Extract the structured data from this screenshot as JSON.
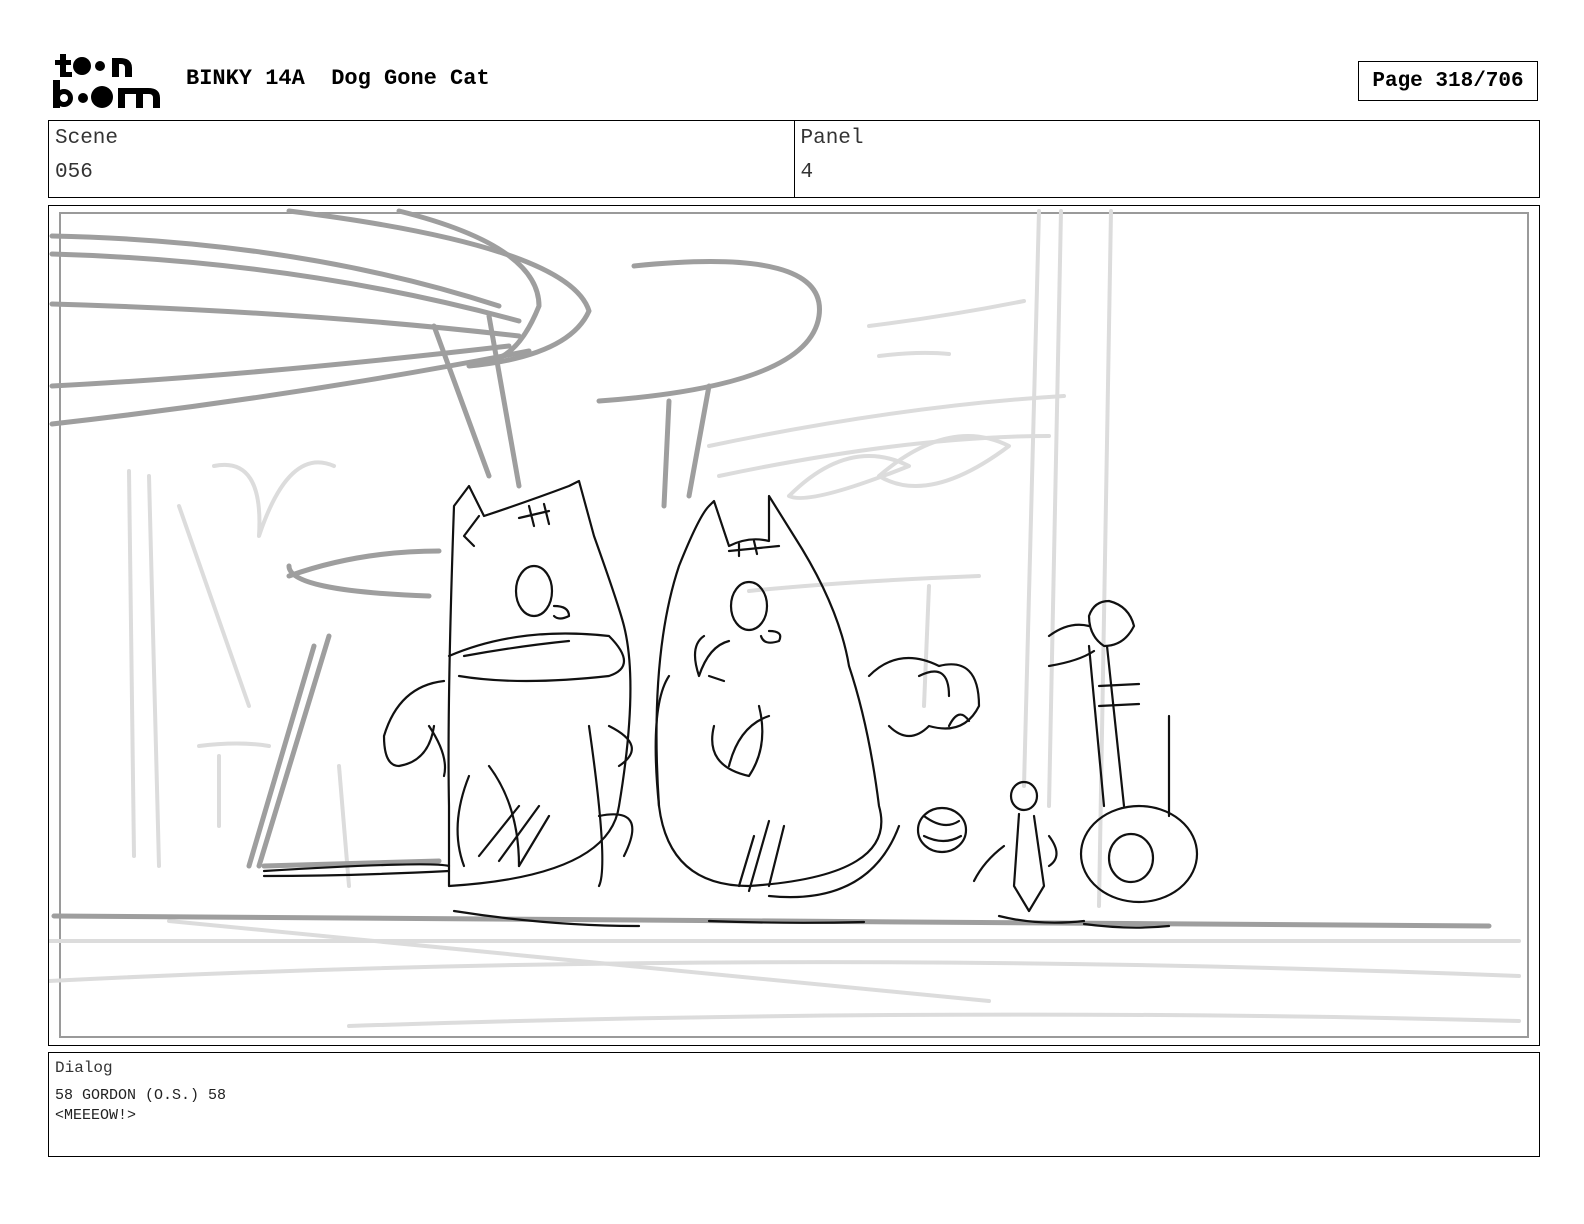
{
  "header": {
    "logo_text": "toon boom",
    "show_code": "BINKY 14A",
    "episode_title": "Dog Gone Cat",
    "page_label": "Page 318/706"
  },
  "info": {
    "scene_label": "Scene",
    "scene_value": "056",
    "panel_label": "Panel",
    "panel_value": "4"
  },
  "panel": {
    "content": "storyboard-sketch",
    "line_colors": {
      "foreground": "#111111",
      "midground": "#9e9e9e",
      "background": "#dcdcdc"
    }
  },
  "dialog": {
    "label": "Dialog",
    "line1": "58 GORDON (O.S.) 58",
    "line2": "<MEEEOW!>"
  }
}
